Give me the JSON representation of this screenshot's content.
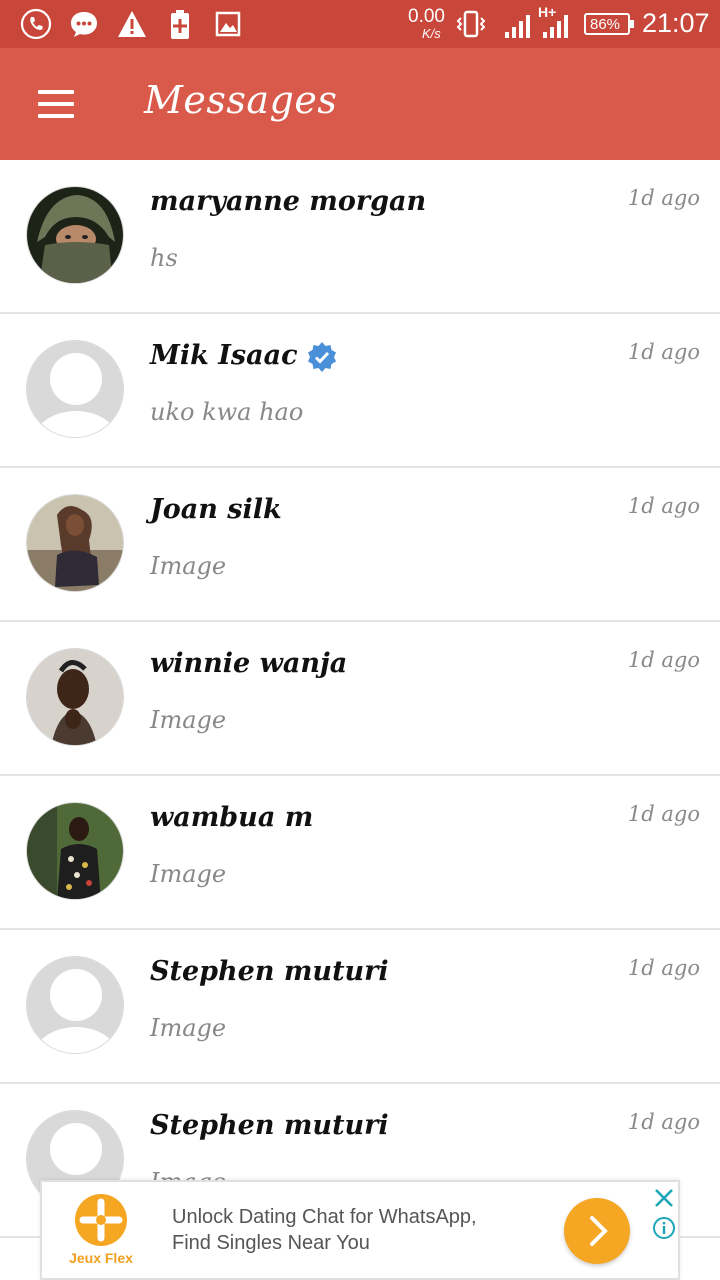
{
  "status_bar": {
    "net_speed_value": "0.00",
    "net_speed_unit": "K/s",
    "network_type": "H+",
    "battery": "86%",
    "time": "21:07",
    "icons": [
      "phone-call-icon",
      "chat-bubble-icon",
      "warning-icon",
      "battery-saver-icon",
      "gallery-icon",
      "vibrate-icon",
      "signal-icon"
    ]
  },
  "header": {
    "title": "Messages",
    "menu_icon": "hamburger-menu-icon"
  },
  "conversations": [
    {
      "name": "maryanne morgan",
      "message": "hs",
      "time": "1d ago",
      "avatar": "photo-green-headscarf",
      "verified": false
    },
    {
      "name": "Mik Isaac",
      "message": "uko kwa hao",
      "time": "1d ago",
      "avatar": "placeholder",
      "verified": true
    },
    {
      "name": "Joan silk",
      "message": "Image",
      "time": "1d ago",
      "avatar": "photo-two-people",
      "verified": false
    },
    {
      "name": "winnie wanja",
      "message": "Image",
      "time": "1d ago",
      "avatar": "photo-woman-portrait",
      "verified": false
    },
    {
      "name": "wambua m",
      "message": "Image",
      "time": "1d ago",
      "avatar": "photo-man-floral-shirt",
      "verified": false
    },
    {
      "name": "Stephen muturi",
      "message": "Image",
      "time": "1d ago",
      "avatar": "placeholder",
      "verified": false
    },
    {
      "name": "Stephen muturi",
      "message": "Image",
      "time": "1d ago",
      "avatar": "placeholder",
      "verified": false
    }
  ],
  "ad": {
    "brand": "Jeux Flex",
    "text": "Unlock Dating Chat for WhatsApp, Find Singles Near You",
    "cta_icon": "chevron-right-icon",
    "close_icon": "close-icon",
    "info_icon": "info-icon"
  },
  "colors": {
    "status_bar": "#c9463a",
    "app_bar": "#d95a4b",
    "verified_badge": "#4a90d9",
    "ad_cta": "#f5a623",
    "ad_icons": "#1aa6b7"
  }
}
